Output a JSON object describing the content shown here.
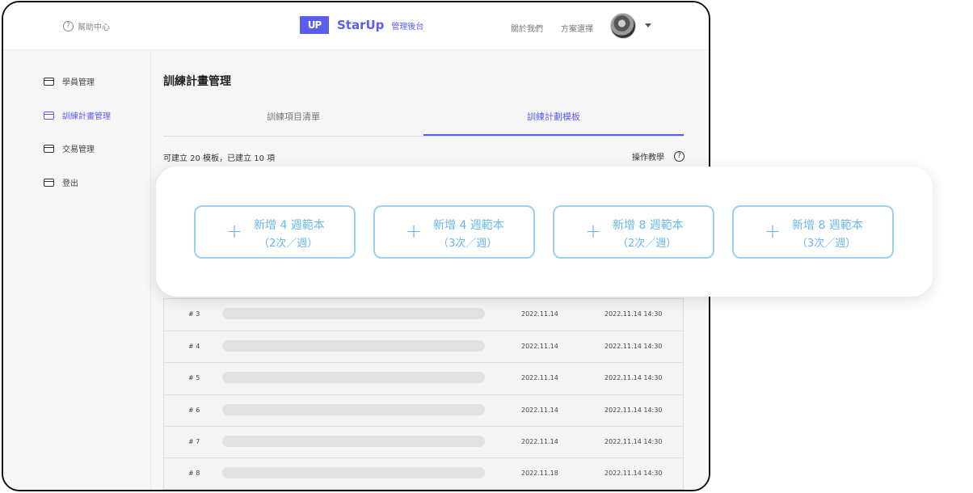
{
  "header": {
    "help_label": "幫助中心",
    "help_icon": "?",
    "logo_text": "UP",
    "brand_name": "StarUp",
    "brand_sub": "管理後台",
    "nav": [
      "關於我們",
      "方案選擇"
    ]
  },
  "sidebar": {
    "items": [
      {
        "label": "學員管理",
        "active": false
      },
      {
        "label": "訓練計畫管理",
        "active": true
      },
      {
        "label": "交易管理",
        "active": false
      },
      {
        "label": "登出",
        "active": false
      }
    ]
  },
  "main": {
    "title": "訓練計畫管理",
    "tabs": [
      {
        "label": "訓練項目清單",
        "active": false
      },
      {
        "label": "訓練計劃模板",
        "active": true
      }
    ],
    "count_text": "可建立 20 模板，已建立 10 項",
    "tutorial_label": "操作教學",
    "tutorial_icon": "?"
  },
  "templates": [
    {
      "line1": "新增 4 週範本",
      "line2": "（2次／週）"
    },
    {
      "line1": "新增 4 週範本",
      "line2": "（3次／週）"
    },
    {
      "line1": "新增 8 週範本",
      "line2": "（2次／週）"
    },
    {
      "line1": "新增 8 週範本",
      "line2": "（3次／週）"
    }
  ],
  "table": {
    "rows": [
      {
        "num": "# 3",
        "created": "2022.11.14",
        "updated": "2022.11.14  14:30"
      },
      {
        "num": "# 4",
        "created": "2022.11.14",
        "updated": "2022.11.14  14:30"
      },
      {
        "num": "# 5",
        "created": "2022.11.14",
        "updated": "2022.11.14  14:30"
      },
      {
        "num": "# 6",
        "created": "2022.11.14",
        "updated": "2022.11.14  14:30"
      },
      {
        "num": "# 7",
        "created": "2022.11.14",
        "updated": "2022.11.14  14:30"
      },
      {
        "num": "# 8",
        "created": "2022.11.18",
        "updated": "2022.11.14  14:30"
      }
    ]
  },
  "colors": {
    "accent": "#5b5df0",
    "template_border": "#9fcff0",
    "template_text": "#68b8ea"
  }
}
